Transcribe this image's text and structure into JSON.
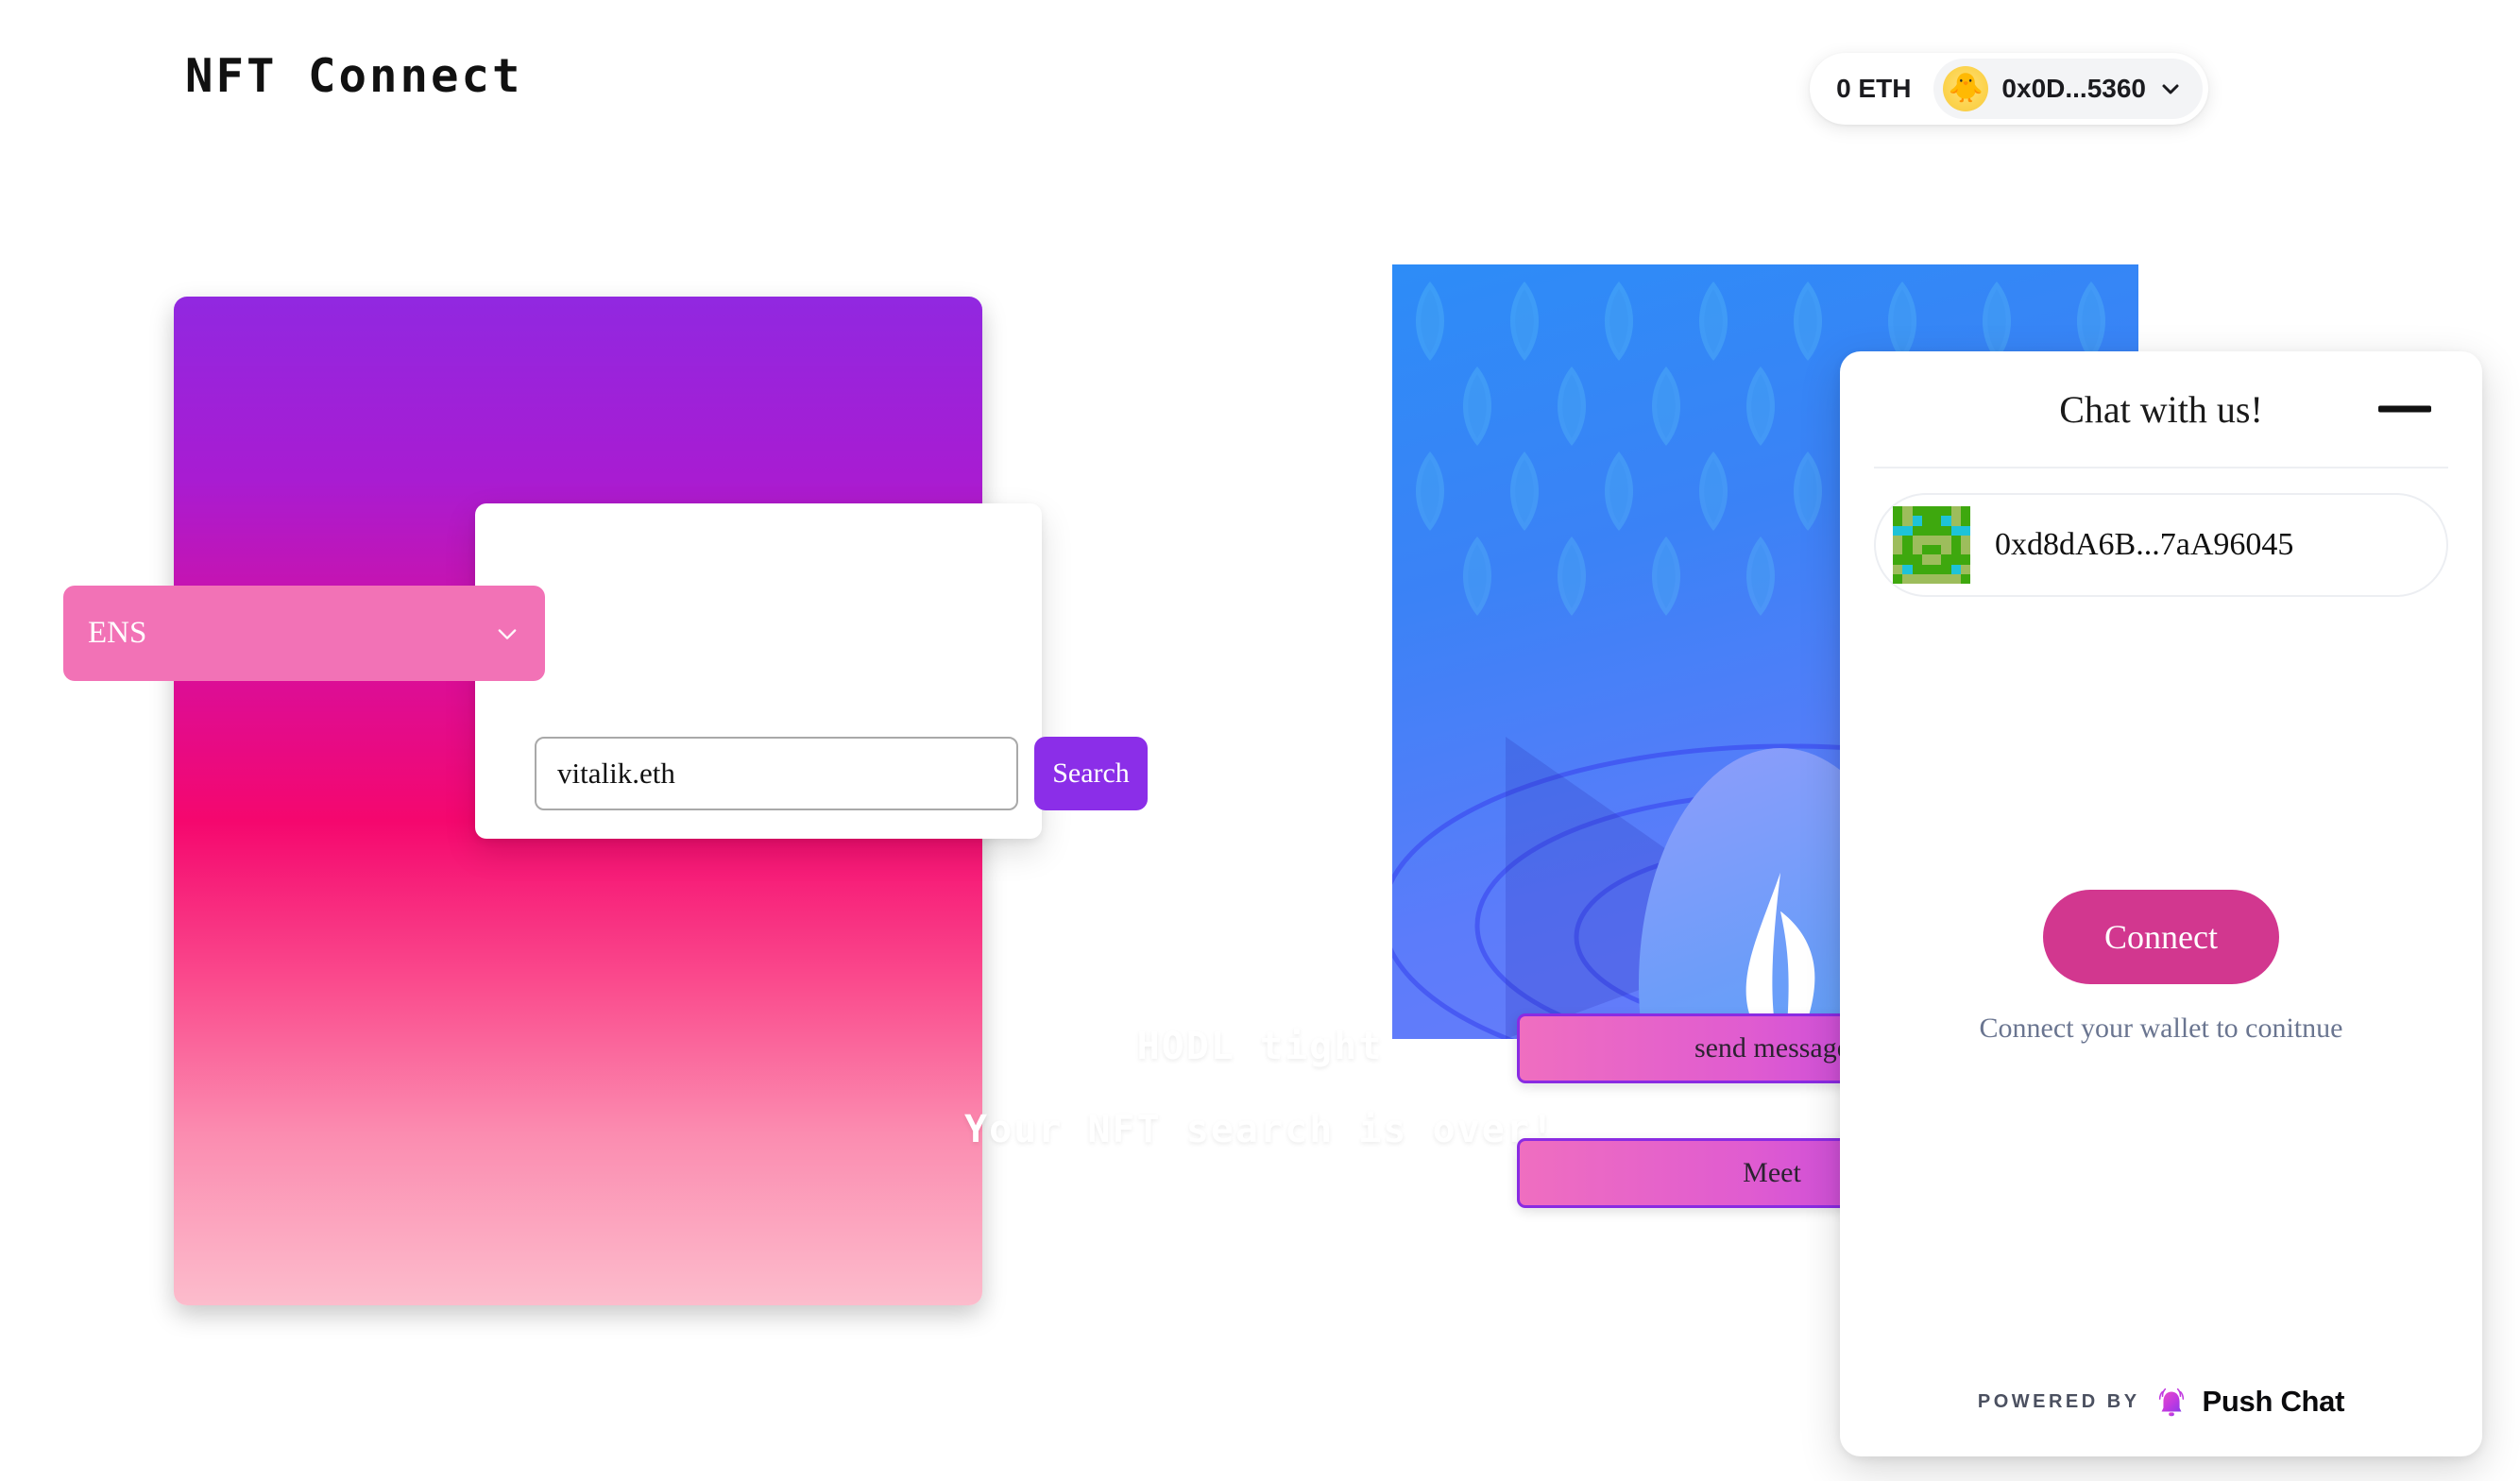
{
  "header": {
    "app_title": "NFT Connect",
    "wallet": {
      "balance": "0 ETH",
      "address": "0x0D...5360",
      "avatar_icon": "chick-emoji",
      "chevron_icon": "chevron-down-icon"
    }
  },
  "nft_card": {
    "tagline_line1": "HODL tight",
    "tagline_line2": "Your NFT search is over!",
    "gradient_top": "#9128e0",
    "gradient_mid": "#f5076e",
    "gradient_bottom": "#fcbccc"
  },
  "search": {
    "select_value": "ENS",
    "select_options": [
      "ENS"
    ],
    "select_chevron_icon": "chevron-down-icon",
    "input_value": "vitalik.eth",
    "input_placeholder": "vitalik.eth",
    "button_label": "Search",
    "select_color": "#f272b6",
    "button_color": "#8b2ee8"
  },
  "nft_preview": {
    "artwork_name": "ens-logo-artwork",
    "base_color": "#3b82f6"
  },
  "actions": {
    "send_message_label": "send message",
    "meet_label": "Meet",
    "border_color": "#8a2be2"
  },
  "chat": {
    "title": "Chat with us!",
    "minimize_icon": "minimize-icon",
    "contact": {
      "address": "0xd8dA6B...7aA96045",
      "avatar_icon": "blockie-avatar"
    },
    "connect_button_label": "Connect",
    "connect_hint": "Connect your wallet to conitnue",
    "connect_button_color": "#d2378f",
    "footer": {
      "powered_by": "POWERED BY",
      "brand": "Push Chat",
      "brand_icon": "push-bell-icon"
    }
  }
}
